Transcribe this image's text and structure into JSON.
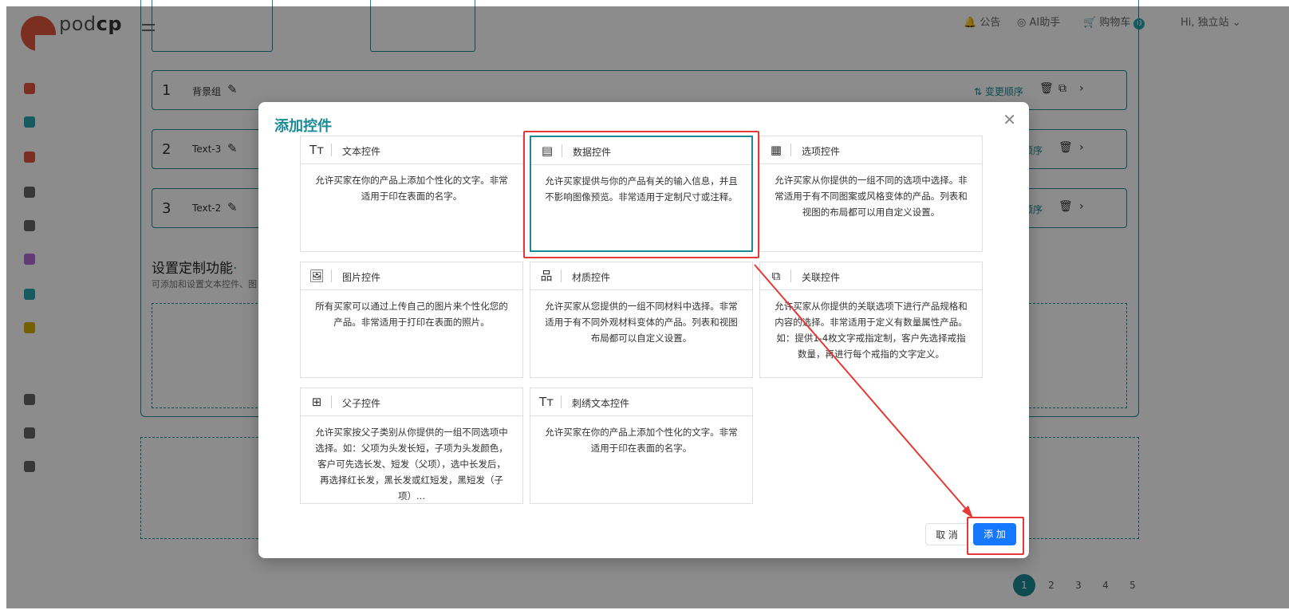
{
  "header": {
    "logo_text": "podcp",
    "notice_label": "公告",
    "ai_label": "AI助手",
    "cart_label": "购物车",
    "cart_count": "0",
    "greeting": "Hi, 独立站"
  },
  "background": {
    "rows": [
      {
        "num": "1",
        "name": "背景组"
      },
      {
        "num": "2",
        "name": "Text-3"
      },
      {
        "num": "3",
        "name": "Text-2"
      }
    ],
    "change_order_label": "变更顺序",
    "section_title": "设置定制功能",
    "section_subtitle": "可添加和设置文本控件、图",
    "pager": [
      "1",
      "2",
      "3",
      "4",
      "5"
    ]
  },
  "modal": {
    "title": "添加控件",
    "cancel_label": "取 消",
    "add_label": "添 加",
    "controls": [
      {
        "icon": "text-icon",
        "name": "文本控件",
        "desc": "允许买家在你的产品上添加个性化的文字。非常适用于印在表面的名字。"
      },
      {
        "icon": "data-icon",
        "name": "数据控件",
        "desc": "允许买家提供与你的产品有关的输入信息，并且不影响图像预览。非常适用于定制尺寸或注释。"
      },
      {
        "icon": "options-icon",
        "name": "选项控件",
        "desc": "允许买家从你提供的一组不同的选项中选择。非常适用于有不同图案或风格变体的产品。列表和视图的布局都可以用自定义设置。"
      },
      {
        "icon": "image-icon",
        "name": "图片控件",
        "desc": "所有买家可以通过上传自己的图片来个性化您的产品。非常适用于打印在表面的照片。"
      },
      {
        "icon": "material-icon",
        "name": "材质控件",
        "desc": "允许买家从您提供的一组不同材料中选择。非常适用于有不同外观材料变体的产品。列表和视图布局都可以自定义设置。"
      },
      {
        "icon": "link-icon",
        "name": "关联控件",
        "desc": "允许买家从你提供的关联选项下进行产品规格和内容的选择。非常适用于定义有数量属性产品。如：提供1-4枚文字戒指定制，客户先选择戒指数量，再进行每个戒指的文字定义。"
      },
      {
        "icon": "parent-child-icon",
        "name": "父子控件",
        "desc": "允许买家按父子类别从你提供的一组不同选项中选择。如：父项为头发长短，子项为头发颜色，客户可先选长发、短发（父项），选中长发后，再选择红长发，黑长发或红短发，黑短发（子项）..."
      },
      {
        "icon": "embroidery-text-icon",
        "name": "刺绣文本控件",
        "desc": "允许买家在你的产品上添加个性化的文字。非常适用于印在表面的名字。"
      }
    ]
  },
  "colors": {
    "accent": "#1a8a96",
    "highlight": "#e53935",
    "primary_button": "#1677ff"
  }
}
